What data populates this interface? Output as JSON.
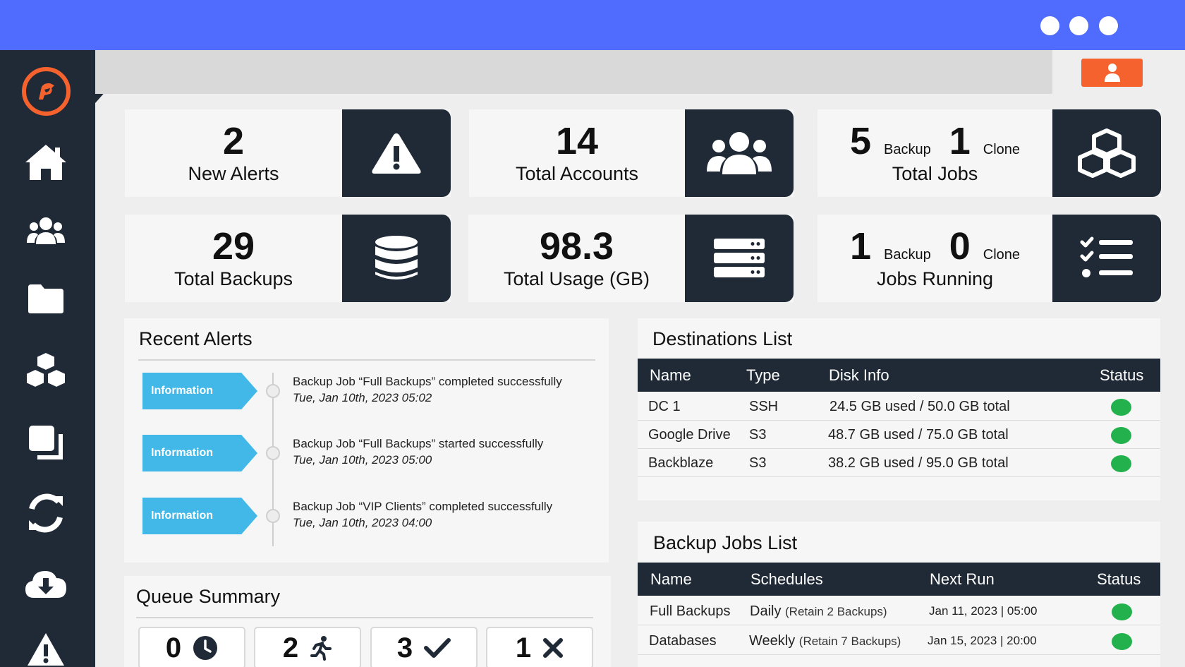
{
  "colors": {
    "topbar": "#4f6cff",
    "sidebar": "#1f2a36",
    "accent_orange": "#f5622d",
    "info_tag": "#41b8e8",
    "status_ok": "#22b14c"
  },
  "window": {
    "controls": [
      "dot",
      "dot",
      "dot"
    ]
  },
  "sidebar": {
    "logo_icon": "logo-icon",
    "items": [
      {
        "icon": "home-icon"
      },
      {
        "icon": "users-icon"
      },
      {
        "icon": "folder-icon"
      },
      {
        "icon": "cubes-icon"
      },
      {
        "icon": "clone-icon"
      },
      {
        "icon": "sync-icon"
      },
      {
        "icon": "cloud-download-icon"
      },
      {
        "icon": "warning-icon"
      }
    ]
  },
  "header": {
    "user_icon": "user-icon"
  },
  "stats": {
    "new_alerts": {
      "value": "2",
      "label": "New Alerts",
      "icon": "warning-icon"
    },
    "total_accounts": {
      "value": "14",
      "label": "Total Accounts",
      "icon": "users-icon"
    },
    "total_jobs": {
      "backup_value": "5",
      "backup_label": "Backup",
      "clone_value": "1",
      "clone_label": "Clone",
      "label": "Total Jobs",
      "icon": "cubes-icon"
    },
    "total_backups": {
      "value": "29",
      "label": "Total Backups",
      "icon": "database-icon"
    },
    "total_usage": {
      "value": "98.3",
      "label": "Total Usage (GB)",
      "icon": "server-icon"
    },
    "jobs_running": {
      "backup_value": "1",
      "backup_label": "Backup",
      "clone_value": "0",
      "clone_label": "Clone",
      "label": "Jobs Running",
      "icon": "tasks-icon"
    }
  },
  "recent_alerts": {
    "title": "Recent Alerts",
    "items": [
      {
        "tag": "Information",
        "message": "Backup Job “Full Backups” completed successfully",
        "time": "Tue, Jan 10th, 2023 05:02"
      },
      {
        "tag": "Information",
        "message": "Backup Job “Full Backups” started successfully",
        "time": "Tue, Jan 10th, 2023 05:00"
      },
      {
        "tag": "Information",
        "message": "Backup Job “VIP Clients” completed successfully",
        "time": "Tue, Jan 10th, 2023 04:00"
      }
    ]
  },
  "queue_summary": {
    "title": "Queue Summary",
    "items": [
      {
        "value": "0",
        "icon": "clock-icon"
      },
      {
        "value": "2",
        "icon": "running-icon"
      },
      {
        "value": "3",
        "icon": "check-icon"
      },
      {
        "value": "1",
        "icon": "x-icon"
      }
    ]
  },
  "destinations": {
    "title": "Destinations List",
    "columns": [
      "Name",
      "Type",
      "Disk Info",
      "Status"
    ],
    "rows": [
      {
        "name": "DC 1",
        "type": "SSH",
        "disk": "24.5 GB used / 50.0 GB total",
        "status": "ok"
      },
      {
        "name": "Google Drive",
        "type": "S3",
        "disk": "48.7 GB used / 75.0 GB total",
        "status": "ok"
      },
      {
        "name": "Backblaze",
        "type": "S3",
        "disk": "38.2 GB used / 95.0 GB total",
        "status": "ok"
      }
    ]
  },
  "backup_jobs": {
    "title": "Backup Jobs List",
    "columns": [
      "Name",
      "Schedules",
      "Next Run",
      "Status"
    ],
    "rows": [
      {
        "name": "Full Backups",
        "schedule": "Daily",
        "retain": "(Retain 2 Backups)",
        "next_run": "Jan 11, 2023 | 05:00",
        "status": "ok"
      },
      {
        "name": "Databases",
        "schedule": "Weekly",
        "retain": "(Retain 7 Backups)",
        "next_run": "Jan 15, 2023 | 20:00",
        "status": "ok"
      }
    ]
  }
}
